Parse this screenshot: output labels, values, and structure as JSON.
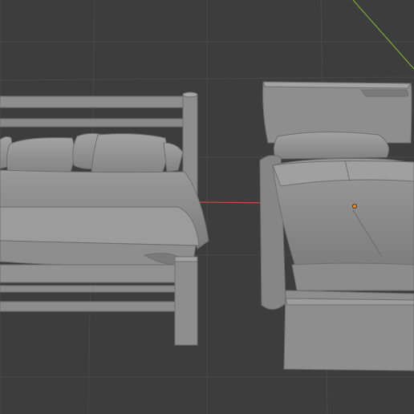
{
  "viewport": {
    "name": "3D Viewport",
    "background_color": "#3d3d3d",
    "grid_color": "#4a4a4a",
    "x_axis_color": "#c94a4a",
    "y_axis_color": "#7ca83a",
    "mesh_color": "#8a8a8a",
    "origin_color": "#e8862a"
  },
  "objects": [
    {
      "name": "double-bed",
      "kind": "mesh"
    },
    {
      "name": "single-bed",
      "kind": "mesh",
      "selected_origin": true
    }
  ]
}
